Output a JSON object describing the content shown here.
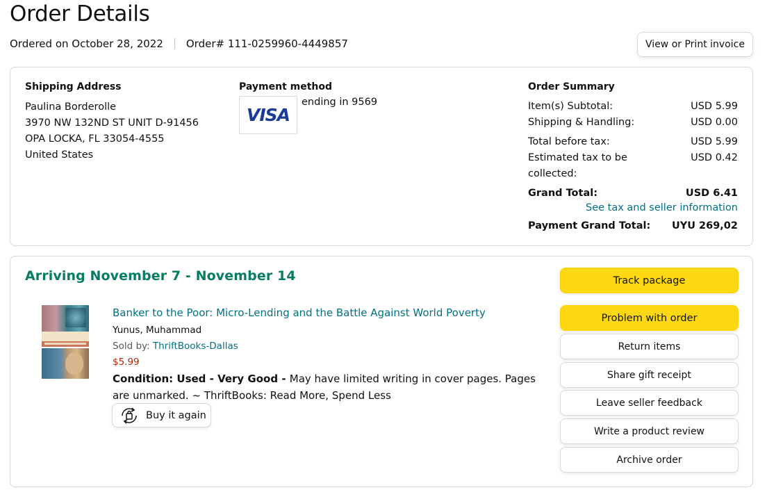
{
  "page": {
    "title": "Order Details",
    "ordered_on": "Ordered on October 28, 2022",
    "order_number": "Order# 111-0259960-4449857",
    "invoice_button": "View or Print invoice"
  },
  "shipping": {
    "heading": "Shipping Address",
    "lines": [
      "Paulina Borderolle",
      "3970 NW 132ND ST UNIT D-91456",
      "OPA LOCKA, FL 33054-4555",
      "United States"
    ]
  },
  "payment": {
    "heading": "Payment method",
    "card_brand": "VISA",
    "ending": "ending in 9569"
  },
  "summary": {
    "heading": "Order Summary",
    "subtotal_label": "Item(s) Subtotal:",
    "subtotal_value": "USD 5.99",
    "shipping_label": "Shipping & Handling:",
    "shipping_value": "USD 0.00",
    "before_tax_label": "Total before tax:",
    "before_tax_value": "USD 5.99",
    "tax_label_1": "Estimated tax to be",
    "tax_label_2": "collected:",
    "tax_value": "USD 0.42",
    "grand_label": "Grand Total:",
    "grand_value": "USD 6.41",
    "tax_link": "See tax and seller information",
    "payment_grand_label": "Payment Grand Total:",
    "payment_grand_value": "UYU 269,02"
  },
  "shipment": {
    "arriving": "Arriving November 7 - November 14",
    "item": {
      "title": "Banker to the Poor: Micro-Lending and the Battle Against World Poverty",
      "author": "Yunus, Muhammad",
      "sold_by_label": "Sold by: ",
      "seller": "ThriftBooks-Dallas",
      "price": "$5.99",
      "condition_label": "Condition: Used - Very Good - ",
      "condition_text": "May have limited writing in cover pages. Pages are unmarked. ~ ThriftBooks: Read More, Spend Less",
      "buy_again": "Buy it again"
    },
    "actions": {
      "track": "Track package",
      "problem": "Problem with order",
      "return": "Return items",
      "gift": "Share gift receipt",
      "feedback": "Leave seller feedback",
      "review": "Write a product review",
      "archive": "Archive order"
    }
  },
  "colors": {
    "link": "#007185",
    "arriving": "#067d62",
    "price": "#b12704",
    "primary_button": "#ffd814",
    "visa": "#1a3c96"
  }
}
